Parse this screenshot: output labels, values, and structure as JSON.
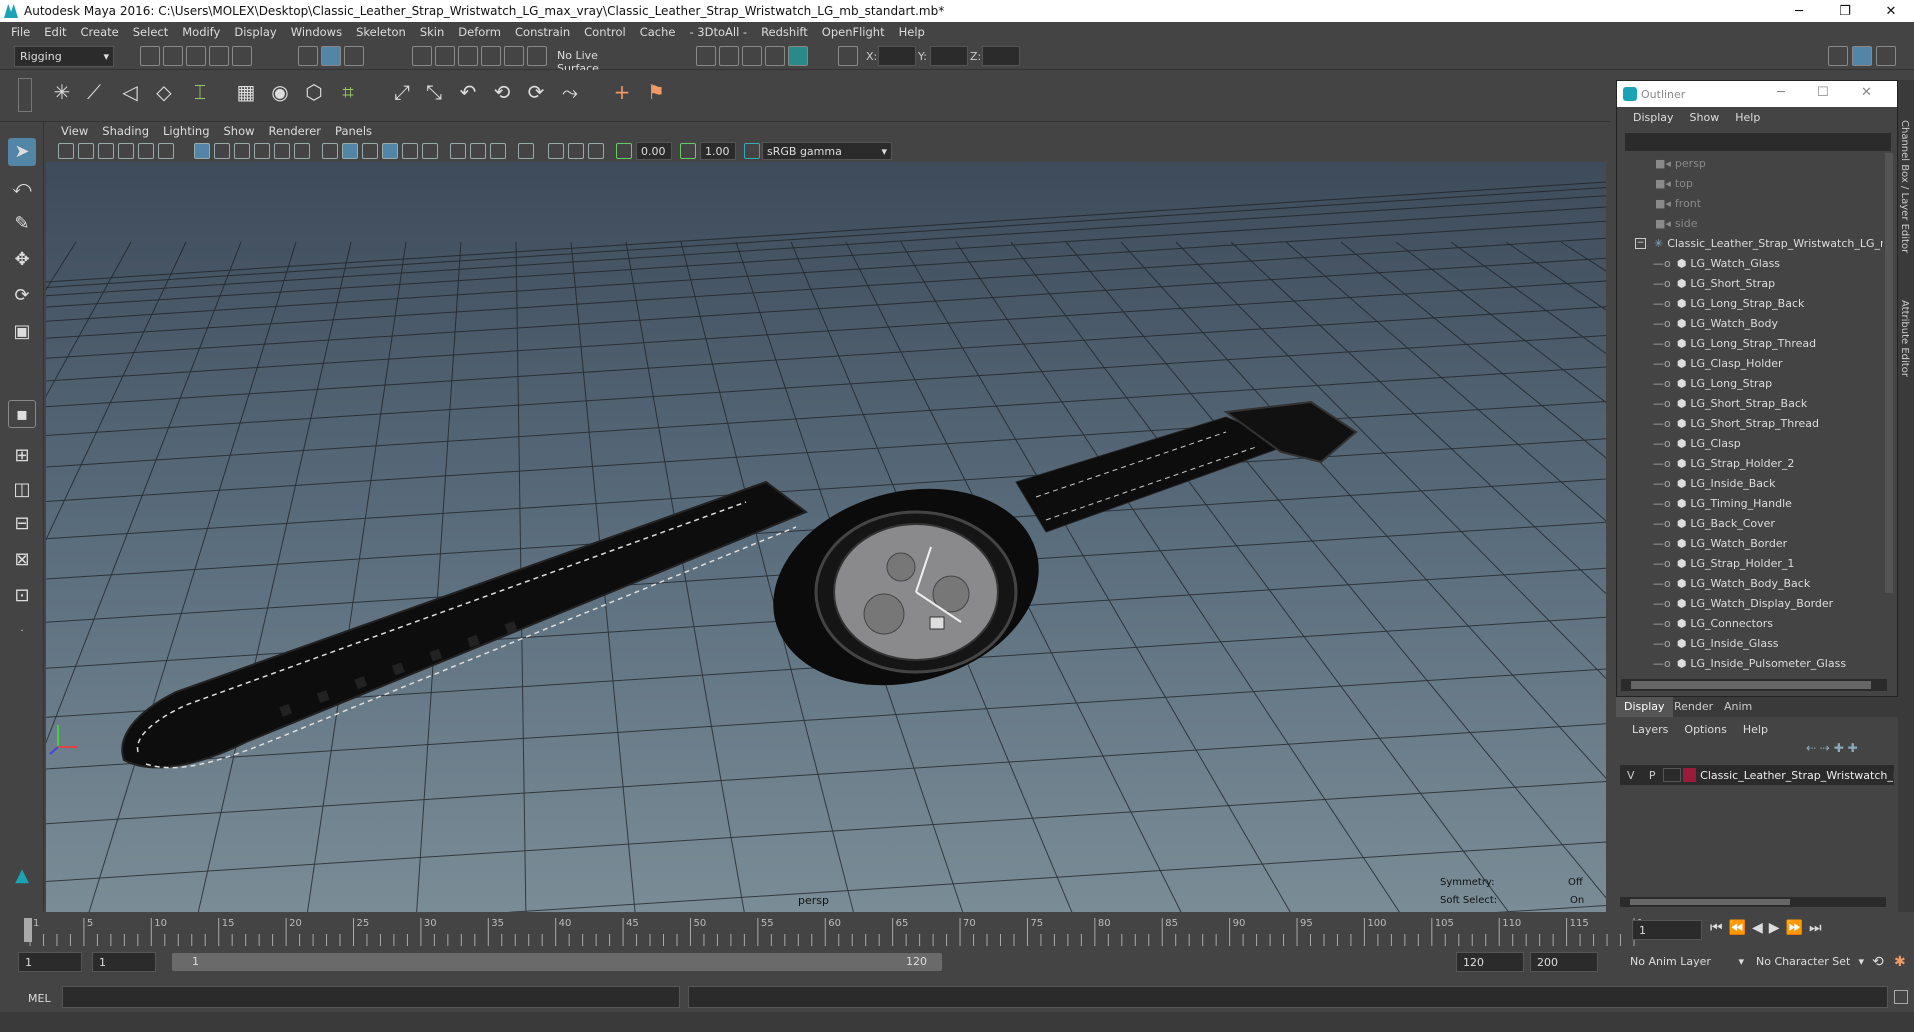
{
  "window": {
    "title": "Autodesk Maya 2016: C:\\Users\\MOLEX\\Desktop\\Classic_Leather_Strap_Wristwatch_LG_max_vray\\Classic_Leather_Strap_Wristwatch_LG_mb_standart.mb*"
  },
  "menubar": [
    "File",
    "Edit",
    "Create",
    "Select",
    "Modify",
    "Display",
    "Windows",
    "Skeleton",
    "Skin",
    "Deform",
    "Constrain",
    "Control",
    "Cache",
    "- 3DtoAll -",
    "Redshift",
    "OpenFlight",
    "Help"
  ],
  "statusline": {
    "mode": "Rigging",
    "live_surface": "No Live Surface",
    "x_label": "X:",
    "y_label": "Y:",
    "z_label": "Z:"
  },
  "panel_menu": [
    "View",
    "Shading",
    "Lighting",
    "Show",
    "Renderer",
    "Panels"
  ],
  "panel_toolbar": {
    "exposure": "0.00",
    "gamma": "1.00",
    "color_space": "sRGB gamma"
  },
  "viewport": {
    "camera": "persp",
    "symmetry_label": "Symmetry:",
    "symmetry_value": "Off",
    "soft_select_label": "Soft Select:",
    "soft_select_value": "On"
  },
  "timeline": {
    "ticks": [
      "1",
      "5",
      "10",
      "15",
      "20",
      "25",
      "30",
      "35",
      "40",
      "45",
      "50",
      "55",
      "60",
      "65",
      "70",
      "75",
      "80",
      "85",
      "90",
      "95",
      "100",
      "105",
      "110",
      "115",
      "120"
    ],
    "current_frame": "1"
  },
  "range": {
    "start": "1",
    "inner_start": "1",
    "slider_start": "1",
    "slider_end": "120",
    "end": "120",
    "max": "200",
    "anim_layer": "No Anim Layer",
    "character_set": "No Character Set"
  },
  "cmdline": {
    "label": "MEL"
  },
  "outliner": {
    "title": "Outliner",
    "menu": [
      "Display",
      "Show",
      "Help"
    ],
    "cameras": [
      "persp",
      "top",
      "front",
      "side"
    ],
    "group": "Classic_Leather_Strap_Wristwatch_LG_n",
    "children": [
      "LG_Watch_Glass",
      "LG_Short_Strap",
      "LG_Long_Strap_Back",
      "LG_Watch_Body",
      "LG_Long_Strap_Thread",
      "LG_Clasp_Holder",
      "LG_Long_Strap",
      "LG_Short_Strap_Back",
      "LG_Short_Strap_Thread",
      "LG_Clasp",
      "LG_Strap_Holder_2",
      "LG_Inside_Back",
      "LG_Timing_Handle",
      "LG_Back_Cover",
      "LG_Watch_Border",
      "LG_Strap_Holder_1",
      "LG_Watch_Body_Back",
      "LG_Watch_Display_Border",
      "LG_Connectors",
      "LG_Inside_Glass",
      "LG_Inside_Pulsometer_Glass"
    ]
  },
  "layers": {
    "tabs": [
      "Display",
      "Render",
      "Anim"
    ],
    "menu": [
      "Layers",
      "Options",
      "Help"
    ],
    "row": {
      "v": "V",
      "p": "P",
      "name": "Classic_Leather_Strap_Wristwatch_L",
      "color": "#9b1b3a"
    }
  },
  "side_tabs": [
    "Channel Box / Layer Editor",
    "Attribute Editor"
  ]
}
